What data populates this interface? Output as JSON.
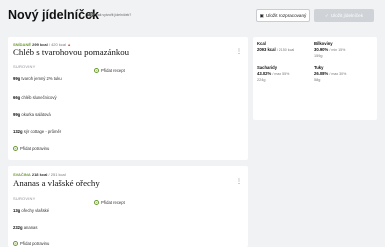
{
  "header": {
    "title": "Nový jídelníček",
    "help_text": "Jak vytvořit jídelníček?",
    "save_button": "Uložit rozpracovaný",
    "save_plan_button": "Uložit jídelníček",
    "help_icon": "question-icon",
    "save_icon": "save-icon",
    "plan_icon": "check-icon"
  },
  "meals": [
    {
      "type": "SNÍDANĚ",
      "kcal": "299 kcal",
      "kcal_target": "/ 420 kcal",
      "name": "Chléb s tvarohovou pomazánkou",
      "ingredients_label": "SUROVINY",
      "ingredients": [
        {
          "amount": "99g",
          "name": "tvaroh jemný 2% tuku"
        },
        {
          "amount": "66g",
          "name": "chléb slunečnicový"
        },
        {
          "amount": "99g",
          "name": "okurka salátová"
        },
        {
          "amount": "132g",
          "name": "sýr cottage - průměr"
        }
      ],
      "add_recipe": "Přidat recept",
      "add_food": "Přidat potravinu"
    },
    {
      "type": "SVAČINA",
      "kcal": "218 kcal",
      "kcal_target": "/ 251 kcal",
      "name": "Ananas a vlašské ořechy",
      "ingredients_label": "SUROVINY",
      "ingredients": [
        {
          "amount": "13g",
          "name": "ořechy vlašské"
        },
        {
          "amount": "232g",
          "name": "ananas"
        }
      ],
      "add_recipe": "Přidat recept",
      "add_food": "Přidat potravinu"
    }
  ],
  "summary": {
    "kcal_label": "Kcal",
    "kcal_value": "2093 kcal",
    "kcal_target": "/ 2150 kcal",
    "protein_label": "Bílkoviny",
    "protein_value": "30.90%",
    "protein_range": "/ min 15%",
    "protein_grams": "159g",
    "carbs_label": "Sacharidy",
    "carbs_value": "43.02%",
    "carbs_range": "/ max 55%",
    "carbs_grams": "224g",
    "fat_label": "Tuky",
    "fat_value": "26.08%",
    "fat_range": "/ max 30%",
    "fat_grams": "58g"
  },
  "colors": {
    "accent": "#6a9b32",
    "background": "#f1f2f4",
    "card": "#ffffff",
    "disabled_button": "#cfd2d7"
  }
}
